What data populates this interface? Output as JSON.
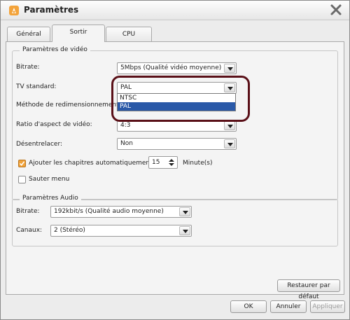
{
  "window": {
    "title": "Paramètres"
  },
  "tabs": [
    {
      "label": "Général"
    },
    {
      "label": "Sortir"
    },
    {
      "label": "CPU"
    }
  ],
  "video": {
    "group_title": "Paramètres de vidéo",
    "bitrate_label": "Bitrate:",
    "bitrate_value": "5Mbps (Qualité vidéo moyenne)",
    "tv_label": "TV standard:",
    "tv_value": "PAL",
    "tv_options": [
      "NTSC",
      "PAL"
    ],
    "resize_label": "Méthode de redimensionnement:",
    "aspect_label": "Ratio d'aspect de vidéo:",
    "aspect_value": "4:3",
    "deinterlace_label": "Désentrelacer:",
    "deinterlace_value": "Non",
    "chapters_label": "Ajouter les chapitres automatiquement:",
    "chapters_value": "15",
    "chapters_unit": "Minute(s)",
    "skip_menu_label": "Sauter menu"
  },
  "audio": {
    "group_title": "Paramètres Audio",
    "bitrate_label": "Bitrate:",
    "bitrate_value": "192kbit/s (Qualité audio moyenne)",
    "channels_label": "Canaux:",
    "channels_value": "2 (Stéréo)"
  },
  "buttons": {
    "restore": "Restaurer par défaut",
    "ok": "OK",
    "cancel": "Annuler",
    "apply": "Appliquer"
  },
  "colors": {
    "selection": "#2a59a8",
    "highlight_ring": "#5a1018",
    "checkbox_checked": "#f0a23a"
  }
}
